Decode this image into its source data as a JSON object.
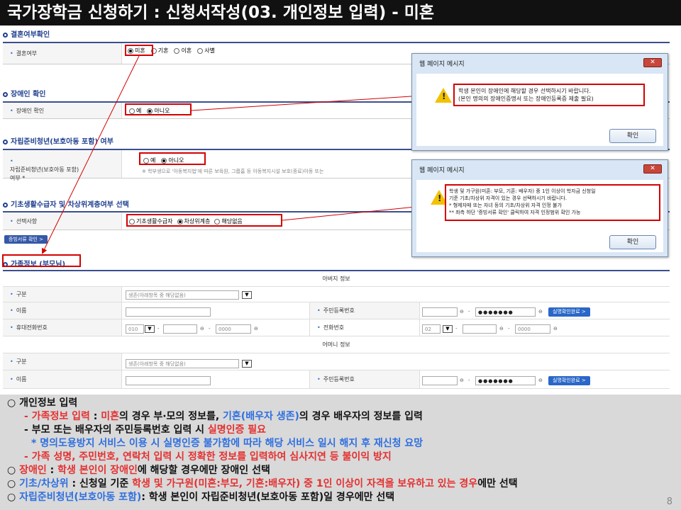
{
  "title": "국가장학금 신청하기 : 신청서작성(03. 개인정보 입력) - 미혼",
  "sections": {
    "marriage": {
      "heading": "결혼여부확인",
      "label": "결혼여부",
      "options": [
        "미혼",
        "기혼",
        "이혼",
        "사별"
      ],
      "selected": "미혼"
    },
    "disability": {
      "heading": "장애인 확인",
      "label": "장애인 확인",
      "options": [
        "예",
        "아니오"
      ],
      "selected": "아니오"
    },
    "independence": {
      "heading": "자립준비청년(보호아동 포함) 여부",
      "label_line1": "자립준비청년(보호아동 포함)",
      "label_line2": "여부 *",
      "options": [
        "예",
        "아니오"
      ],
      "selected": "아니오",
      "note": "※ 학부생으로 '아동복지법'에 따른 보육원, 그룹홈 등 아동복지시설 보호(종료)아동 또는 "
    },
    "basic_living": {
      "heading": "기초생활수급자 및 차상위계층여부 선택",
      "label": "선택사항",
      "options": [
        "기초생활수급자",
        "차상위계층",
        "해당없음"
      ],
      "selected": "차상위계층"
    },
    "doc_check_button": "증빙서류 확인",
    "family": {
      "heading": "가족정보 (부모님)",
      "father_header": "아버지 정보",
      "mother_header": "어머니 정보",
      "label_type": "구분",
      "label_name": "이름",
      "label_mobile": "휴대전화번호",
      "label_rrn": "주민등록번호",
      "label_phone": "전화번호",
      "type_value": "생존(아래항목 중 해당없음)",
      "mobile_prefix": "010",
      "phone_prefix": "02",
      "phone_last": "0000",
      "dash": "-",
      "rrn_masked": "●●●●●●●",
      "verify_button": "실명확인완료"
    }
  },
  "dialog1": {
    "title": "웹 페이지 메시지",
    "line1": "학생 본인이 장애인에 해당할 경우 선택하시기 바랍니다.",
    "line2": "(본인 명의의 장애인증명서 또는 장애인등록증 제출 필요)",
    "ok": "확인"
  },
  "dialog2": {
    "title": "웹 페이지 메시지",
    "line1": "학생 및 가구원(미혼: 부모, 기혼: 배우자) 중 1인 이상이 학자금 신청일",
    "line2": "기준 기초/차상위 자격이 있는 경우 선택하시기 바랍니다.",
    "line3": "* 형제자매 또는 자녀 등의 기초/차상위 자격 인정 불가",
    "line4": "** 좌측 하단 '증빙서류 확인' 클릭하여 자격 인정범위 확인 가능",
    "ok": "확인"
  },
  "bottom": {
    "b1": "○ 개인정보 입력",
    "b2a": "- 가족정보 입력",
    "b2b": " : ",
    "b2c": "미혼",
    "b2d": "의 경우 부·모의 정보를, ",
    "b2e": "기혼(배우자 생존)",
    "b2f": "의 경우 배우자의 정보를 입력",
    "b3a": "- 부모 또는 배우자의 주민등록번호 입력 시 ",
    "b3b": "실명인증 필요",
    "b4": "* 명의도용방지 서비스 이용 시 실명인증 불가함에 따라 해당 서비스 일시 해지 후 재신청 요망",
    "b5": "- 가족 성명, 주민번호, 연락처 입력 시 정확한 정보를 입력하여 심사지연 등 불이익 방지",
    "b6a": "○ ",
    "b6b": "장애인",
    "b6c": " : ",
    "b6d": "학생 본인이 장애인",
    "b6e": "에 해당할 경우에만 장애인 선택",
    "b7a": "○ ",
    "b7b": "기초/차상위",
    "b7c": " : 신청일 기준 ",
    "b7d": "학생 및 가구원(미혼:부모, 기혼:배우자) 중 1인 이상이 자격을 보유하고 있는 경우",
    "b7e": "에만 선택",
    "b8a": "○ ",
    "b8b": "자립준비청년(보호아동 포함)",
    "b8c": ": 학생 본인이 자립준비청년(보호아동 포함)일 경우에만 선택",
    "page": "8"
  },
  "colors": {
    "accent": "#1f3f8f",
    "highlight": "#d40000",
    "blue_text": "#2f6fe0",
    "red_text": "#e53030"
  }
}
